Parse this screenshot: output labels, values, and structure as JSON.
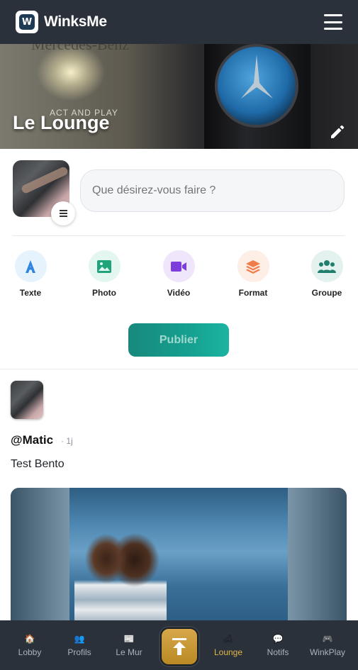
{
  "app": {
    "name": "WinksMe",
    "logo_letter": "W"
  },
  "cover": {
    "title": "Le Lounge",
    "overlay_text": "ACT AND PLAY",
    "faded_text": "Mercedes-Benz"
  },
  "composer": {
    "placeholder": "Que désirez-vous faire ?",
    "actions": [
      {
        "label": "Texte",
        "icon": "text-a-icon",
        "color": "#2f86e0",
        "bg": "#e6f2fc"
      },
      {
        "label": "Photo",
        "icon": "image-icon",
        "color": "#1fa37b",
        "bg": "#e3f6ef"
      },
      {
        "label": "Vidéo",
        "icon": "video-icon",
        "color": "#7d3cdc",
        "bg": "#efe6fb"
      },
      {
        "label": "Format",
        "icon": "layers-icon",
        "color": "#f07c4a",
        "bg": "#fdeee6"
      },
      {
        "label": "Groupe",
        "icon": "users-icon",
        "color": "#1f7e6e",
        "bg": "#e3f2ee"
      }
    ],
    "publish_label": "Publier",
    "publish_color": "#16a08f"
  },
  "post": {
    "username": "@Matic",
    "time": "· 1j",
    "text": "Test Bento"
  },
  "bottom_nav": {
    "items": [
      {
        "label": "Lobby",
        "icon": "house-icon",
        "glyph": "🏠",
        "active": false
      },
      {
        "label": "Profils",
        "icon": "people-icon",
        "glyph": "👥",
        "active": false
      },
      {
        "label": "Le Mur",
        "icon": "wall-icon",
        "glyph": "📰",
        "active": false
      },
      {
        "label": "Lounge",
        "icon": "bed-icon",
        "glyph": "🛋",
        "active": true
      },
      {
        "label": "Notifs",
        "icon": "speech-bubble-icon",
        "glyph": "💬",
        "active": false
      },
      {
        "label": "WinkPlay",
        "icon": "gamepad-icon",
        "glyph": "🎮",
        "active": false
      }
    ],
    "center_icon": "upload-arrow-icon",
    "active_color": "#e0b84a"
  }
}
